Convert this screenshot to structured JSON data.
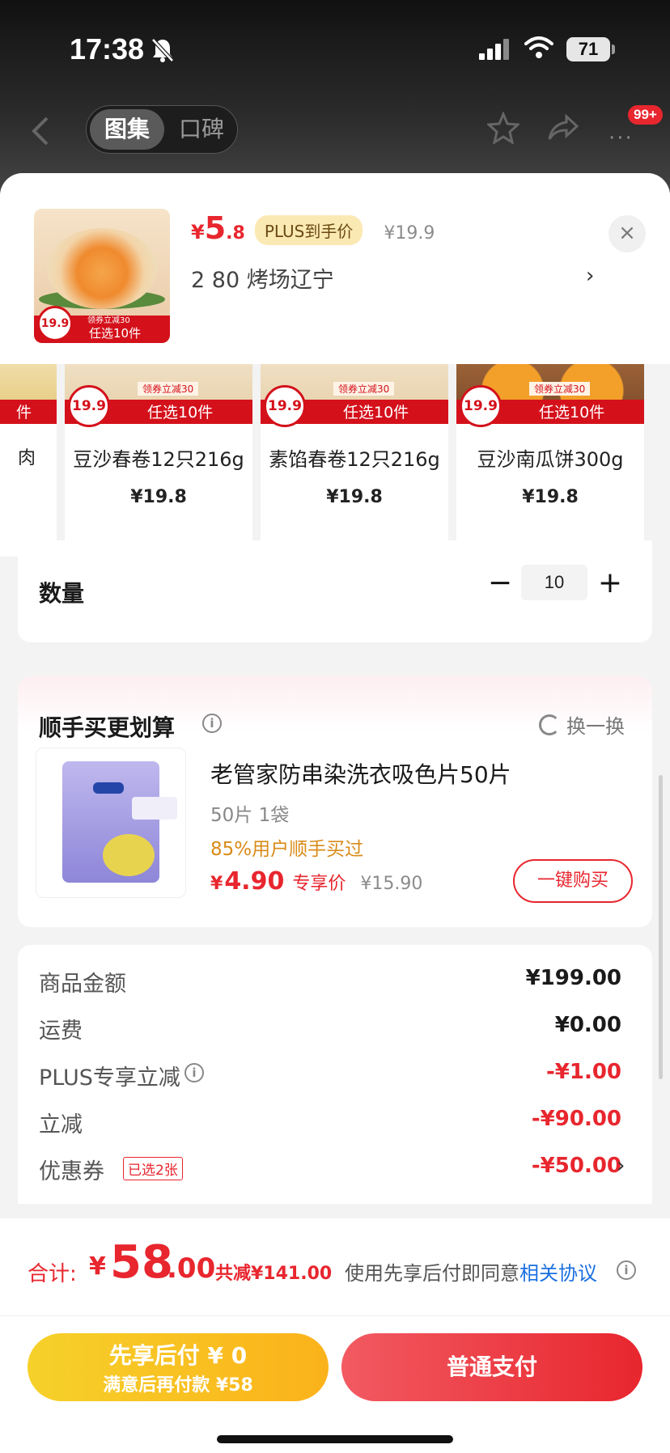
{
  "status_bar": {
    "time": "17:38",
    "battery": "71"
  },
  "nav": {
    "tabs": [
      "图集",
      "口碑"
    ],
    "badge": "99+",
    "more": "···"
  },
  "product": {
    "price_yen": "¥",
    "price_int": "5",
    "price_dec": ".8",
    "plus_badge": "PLUS到手价",
    "original_price": "¥19.9",
    "spec": "2  80 烤场辽宁",
    "chevron": "›",
    "close": "×",
    "thumb_price": "19.9",
    "thumb_tag_small": "领券立减30",
    "thumb_tag": "任选10件"
  },
  "variants": [
    {
      "name": "豆沙春卷12只216g",
      "price": "¥19.8",
      "tag": "任选10件",
      "sub": "领券立减30",
      "circle": "19.9",
      "style": "roll"
    },
    {
      "name": "素馅春卷12只216g",
      "price": "¥19.8",
      "tag": "任选10件",
      "sub": "领券立减30",
      "circle": "19.9",
      "style": "roll"
    },
    {
      "name": "豆沙南瓜饼300g",
      "price": "¥19.8",
      "tag": "任选10件",
      "sub": "领券立减30",
      "circle": "19.9",
      "style": "pumpkin"
    }
  ],
  "partial_variant": {
    "name": "肉",
    "tag": "件"
  },
  "quantity": {
    "label": "数量",
    "minus": "−",
    "value": "10",
    "plus": "+"
  },
  "addon": {
    "title": "顺手买更划算",
    "info": "i",
    "swap": "换一换",
    "name": "老管家防串染洗衣吸色片50片",
    "spec": "50片 1袋",
    "social": "85%用户顺手买过",
    "price_yen": "¥",
    "price": "4.90",
    "price_label": "专享价",
    "original_price": "¥15.90",
    "buy_button": "一键购买"
  },
  "summary": {
    "rows": [
      {
        "label": "商品金额",
        "value": "¥199.00",
        "red": false
      },
      {
        "label": "运费",
        "value": "¥0.00",
        "red": false
      },
      {
        "label": "PLUS专享立减",
        "value": "-¥1.00",
        "red": true
      },
      {
        "label": "立减",
        "value": "-¥90.00",
        "red": true
      },
      {
        "label": "优惠券",
        "value": "-¥50.00",
        "red": true
      }
    ],
    "coupon_tag": "已选2张",
    "chevron": "›"
  },
  "footer": {
    "total_label": "合计:",
    "total_yen": "¥",
    "total_int": "58",
    "total_dec": ".00",
    "total_saved": "共减¥141.00",
    "agree_text": "使用先享后付即同意",
    "agree_link": "相关协议",
    "btn_later_main": "先享后付 ¥ 0",
    "btn_later_sub": "满意后再付款 ¥58",
    "btn_pay": "普通支付"
  },
  "colors": {
    "accent_red": "#e8262e",
    "plus_gold": "#fbe9b4",
    "later_yellow": "#fbb21a",
    "link_blue": "#1a6fe0"
  }
}
